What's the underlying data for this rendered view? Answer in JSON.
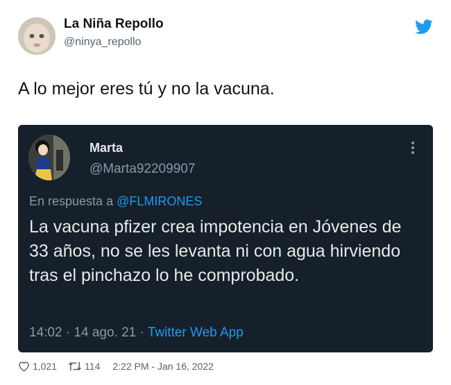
{
  "tweet": {
    "author_name": "La Niña Repollo",
    "author_handle": "@ninya_repollo",
    "text": "A lo mejor eres tú y no la vacuna.",
    "likes": "1,021",
    "retweets": "114",
    "timestamp": "2:22 PM - Jan 16, 2022",
    "brand_color": "#1d9bf0"
  },
  "quoted": {
    "author_name": "Marta",
    "author_handle": "@Marta92209907",
    "reply_prefix": "En respuesta a",
    "reply_to": "@FLMIRONES",
    "body": "La vacuna pfizer crea impotencia en Jóvenes de 33 años, no se les levanta ni con agua hirviendo tras el pinchazo lo he comprobado.",
    "time": "14:02",
    "sep1": "·",
    "date": "14 ago. 21",
    "sep2": "·",
    "source": "Twitter Web App",
    "background": "#15202b"
  },
  "icons": [
    "twitter-bird-icon",
    "more-options-icon",
    "heart-icon",
    "retweet-icon"
  ]
}
